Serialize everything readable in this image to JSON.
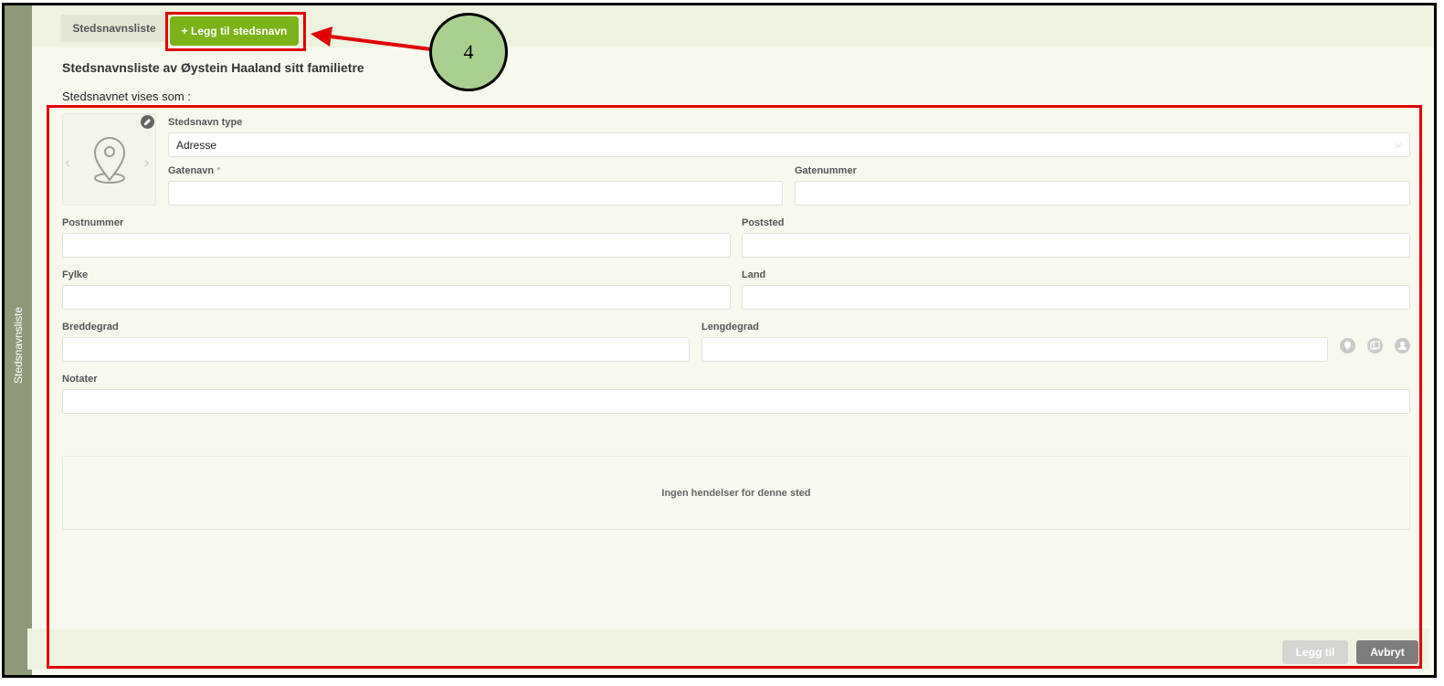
{
  "sidebar": {
    "label": "Stedsnavnsliste"
  },
  "tabs": {
    "list_label": "Stedsnavnsliste",
    "add_label": "+ Legg til stedsnavn"
  },
  "callout": {
    "number": "4"
  },
  "page": {
    "title": "Stedsnavnsliste av Øystein Haaland sitt familietre",
    "shown_as": "Stedsnavnet vises som :"
  },
  "form": {
    "type_label": "Stedsnavn type",
    "type_value": "Adresse",
    "street_label": "Gatenavn",
    "required_mark": "*",
    "street_number_label": "Gatenummer",
    "postcode_label": "Postnummer",
    "city_label": "Poststed",
    "county_label": "Fylke",
    "country_label": "Land",
    "latitude_label": "Breddegrad",
    "longitude_label": "Lengdegrad",
    "notes_label": "Notater"
  },
  "events": {
    "empty_text": "Ingen hendelser for denne sted"
  },
  "footer": {
    "add_label": "Legg til",
    "cancel_label": "Avbryt"
  },
  "icons": [
    "map-pin-icon",
    "edit-icon",
    "chevron-left-icon",
    "chevron-right-icon",
    "location-icon",
    "copy-icon",
    "person-icon"
  ],
  "colors": {
    "accent": "#7ab317",
    "highlight": "#e00000",
    "callout": "#a9d08e",
    "sidebar": "#8e9a77"
  }
}
